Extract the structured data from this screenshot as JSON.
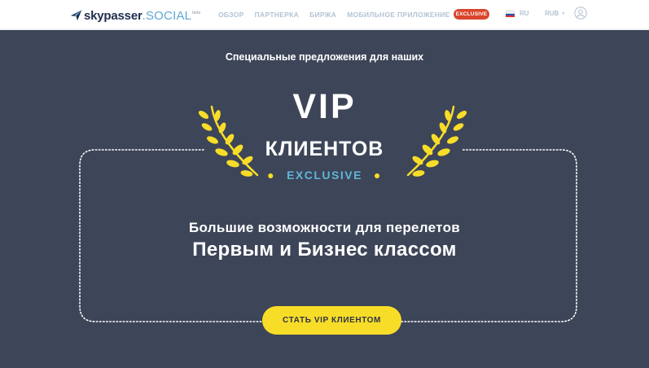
{
  "header": {
    "logo": {
      "main": "skypasser",
      "suffix": ".SOCIAL",
      "badge": "beta"
    },
    "nav": [
      {
        "label": "ОБЗОР"
      },
      {
        "label": "ПАРТНЕРКА"
      },
      {
        "label": "БИРЖА"
      },
      {
        "label": "МОБИЛЬНОЕ ПРИЛОЖЕНИЕ"
      }
    ],
    "exclusive_button": "EXCLUSIVE",
    "language": "RU",
    "currency": "RUB",
    "icons": {
      "user": "user-circle-icon",
      "caret": "caret-down-icon",
      "logo": "plane-icon"
    }
  },
  "hero": {
    "subtitle": "Специальные предложения для наших",
    "vip": "VIP",
    "clients": "КЛИЕНТОВ",
    "exclusive": "EXCLUSIVE",
    "line1": "Большие возможности для перелетов",
    "line2": "Первым и Бизнес классом",
    "cta": "СТАТЬ VIP КЛИЕНТОМ"
  },
  "colors": {
    "background": "#3d4558",
    "accent_yellow": "#f8dd28",
    "accent_blue": "#5fb6d8",
    "exclusive_red": "#d9462d",
    "nav_text": "#b3c3d3"
  }
}
